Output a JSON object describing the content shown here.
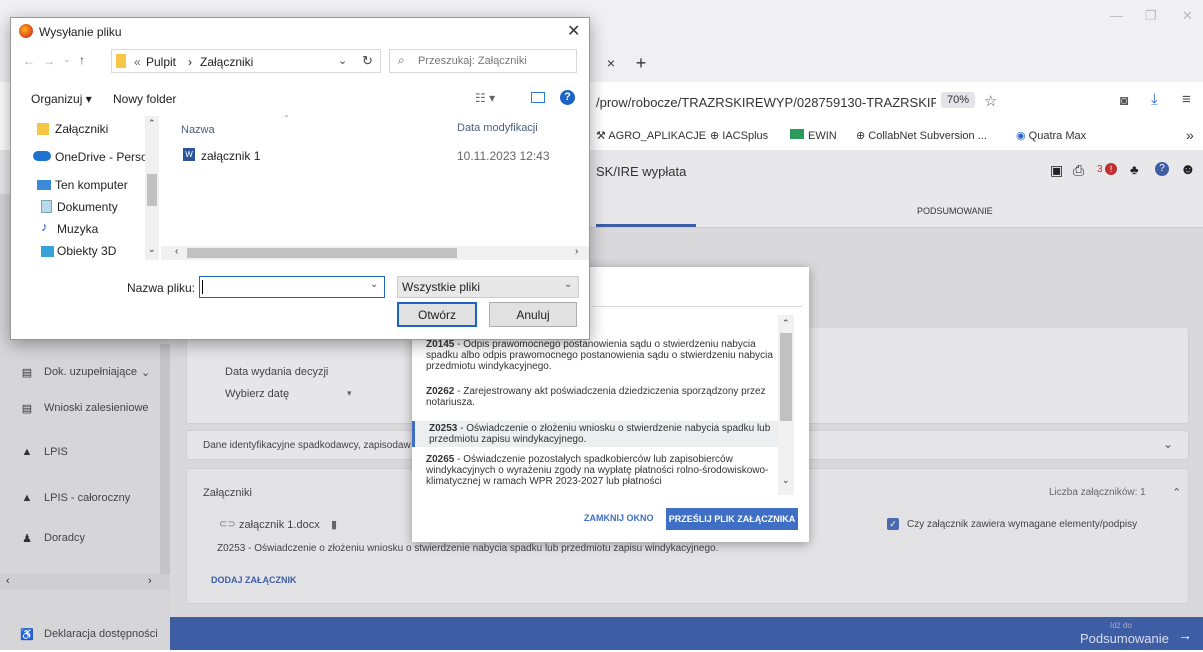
{
  "browser": {
    "new_tab": "+",
    "close_tab": "×",
    "url": "/prow/robocze/TRAZRSKIREWYP/028759130-TRAZRSKIREW",
    "zoom": "70%",
    "bookmarks": [
      "AGRO_APLIKACJE",
      "IACSplus",
      "EWIN",
      "CollabNet Subversion ...",
      "Quatra Max"
    ],
    "more": "»"
  },
  "app": {
    "title": "SK/IRE wypłata",
    "notif_count": "3",
    "tab_summary": "PODSUMOWANIE",
    "sidebar": [
      {
        "label": "Dok. uzupełniające",
        "icon": "document-icon"
      },
      {
        "label": "Wnioski zalesieniowe",
        "icon": "document-icon"
      },
      {
        "label": "LPIS",
        "icon": "mountain-icon"
      },
      {
        "label": "LPIS - całoroczny",
        "icon": "mountain-icon"
      },
      {
        "label": "Doradcy",
        "icon": "person-icon"
      },
      {
        "label": "Deklaracja dostępności",
        "icon": "accessibility-icon"
      }
    ],
    "date_label": "Data wydania decyzji",
    "date_placeholder": "Wybierz datę",
    "heir_panel": "Dane identyfikacyjne spadkodawcy, zapisodaw",
    "attachments_title": "Załączniki",
    "attachments_count": "Liczba załączników: 1",
    "attachment_file": "załącznik 1.docx",
    "attachment_desc": "Z0253 - Oświadczenie o złożeniu wniosku o stwierdzenie nabycia spadku lub przedmiotu zapisu windykacyjnego.",
    "checkbox_label": "Czy załącznik zawiera wymagane elementy/podpisy",
    "add_attachment": "DODAJ ZAŁĄCZNIK",
    "footer_small": "Idź do",
    "footer_big": "Podsumowanie"
  },
  "modal": {
    "options": [
      {
        "code": "Z0145",
        "text": " - Odpis prawomocnego postanowienia sądu o stwierdzeniu nabycia spadku albo odpis prawomocnego postanowienia sądu o stwierdzeniu nabycia przedmiotu windykacyjnego."
      },
      {
        "code": "Z0262",
        "text": " - Zarejestrowany akt poświadczenia dziedziczenia sporządzony przez notariusza."
      },
      {
        "code": "Z0253",
        "text": " - Oświadczenie o złożeniu wniosku o stwierdzenie nabycia spadku lub przedmiotu zapisu windykacyjnego."
      },
      {
        "code": "Z0265",
        "text": " - Oświadczenie pozostałych spadkobierców lub zapisobierców windykacyjnych o wyrażeniu zgody na wypłatę płatności rolno-środowiskowo-klimatycznej w ramach WPR 2023-2027 lub płatności"
      }
    ],
    "close_btn": "ZAMKNIJ OKNO",
    "upload_btn": "PRZEŚLIJ PLIK ZAŁĄCZNIKA"
  },
  "filedialog": {
    "title": "Wysyłanie pliku",
    "path": [
      "Pulpit",
      "Załączniki"
    ],
    "search_placeholder": "Przeszukaj: Załączniki",
    "organize": "Organizuj",
    "new_folder": "Nowy folder",
    "nav_items": [
      "Załączniki",
      "OneDrive - Person",
      "Ten komputer",
      "Dokumenty",
      "Muzyka",
      "Obiekty 3D"
    ],
    "col_name": "Nazwa",
    "col_date": "Data modyfikacji",
    "files": [
      {
        "name": "załącznik 1",
        "date": "10.11.2023 12:43"
      }
    ],
    "filename_label": "Nazwa pliku:",
    "filename_value": "",
    "filter": "Wszystkie pliki",
    "open_btn": "Otwórz",
    "cancel_btn": "Anuluj"
  },
  "colors": {
    "accent": "#3d5ea5",
    "modal_accent": "#3e6fc4"
  }
}
